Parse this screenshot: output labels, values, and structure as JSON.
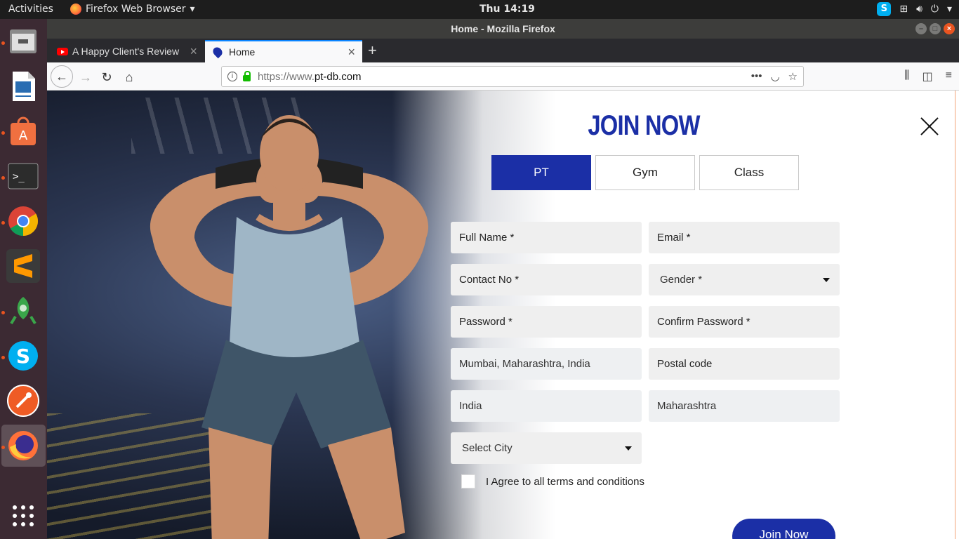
{
  "topbar": {
    "activities": "Activities",
    "app_menu": "Firefox Web Browser",
    "clock": "Thu 14:19"
  },
  "window": {
    "title": "Home - Mozilla Firefox"
  },
  "tabs": [
    {
      "label": "A Happy Client's Review",
      "active": false
    },
    {
      "label": "Home",
      "active": true
    }
  ],
  "url": {
    "prefix": "https://www.",
    "domain": "pt-db.com"
  },
  "dock": {
    "apps": [
      "files-icon",
      "writer-icon",
      "software-icon",
      "terminal-icon",
      "chrome-icon",
      "sublime-icon",
      "robot-icon",
      "skype-icon",
      "postman-icon",
      "firefox-icon",
      "app-grid-icon"
    ]
  },
  "form": {
    "title": "JOIN NOW",
    "types": [
      "PT",
      "Gym",
      "Class"
    ],
    "selected_type": "PT",
    "fields": {
      "full_name": "Full Name *",
      "email": "Email *",
      "contact": "Contact No *",
      "gender": "Gender *",
      "password": "Password *",
      "confirm_password": "Confirm Password *",
      "location": "Mumbai, Maharashtra, India",
      "postal_code": "Postal code",
      "country": "India",
      "state": "Maharashtra",
      "city": "Select City"
    },
    "agree_label": "I Agree to all terms and conditions",
    "submit_label": "Join Now"
  },
  "colors": {
    "brand": "#1b2fa6",
    "ubuntu_orange": "#e95420"
  }
}
